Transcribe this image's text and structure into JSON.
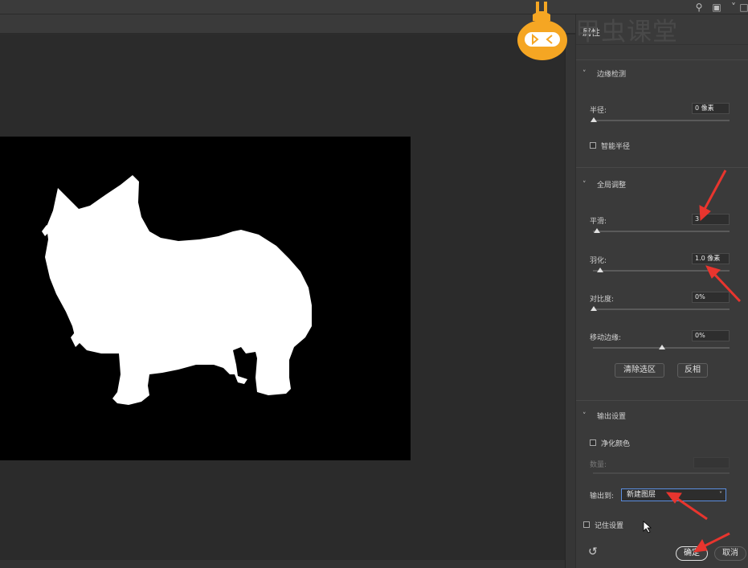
{
  "watermark": {
    "text": "甲虫课堂",
    "logo": "beetle-guitar-logo"
  },
  "panel": {
    "title": "属性",
    "edge_detection": {
      "title": "边缘检测",
      "radius_label": "半径:",
      "radius_value": "0 像素",
      "smart_radius_label": "智能半径"
    },
    "global_refinements": {
      "title": "全局调整",
      "smooth_label": "平滑:",
      "smooth_value": "3",
      "feather_label": "羽化:",
      "feather_value": "1.0 像素",
      "contrast_label": "对比度:",
      "contrast_value": "0%",
      "shift_edge_label": "移动边缘:",
      "shift_edge_value": "0%",
      "clear_selection_button": "清除选区",
      "invert_button": "反相"
    },
    "output_settings": {
      "title": "输出设置",
      "decontaminate_label": "净化颜色",
      "amount_label": "数量:",
      "output_to_label": "输出到:",
      "output_to_value": "新建图层",
      "remember_label": "记住设置"
    },
    "ok_button": "确定",
    "cancel_button": "取消"
  },
  "colors": {
    "accent_arrow": "#e8352e",
    "select_border": "#5b8ee0",
    "logo_orange": "#f5a623"
  }
}
